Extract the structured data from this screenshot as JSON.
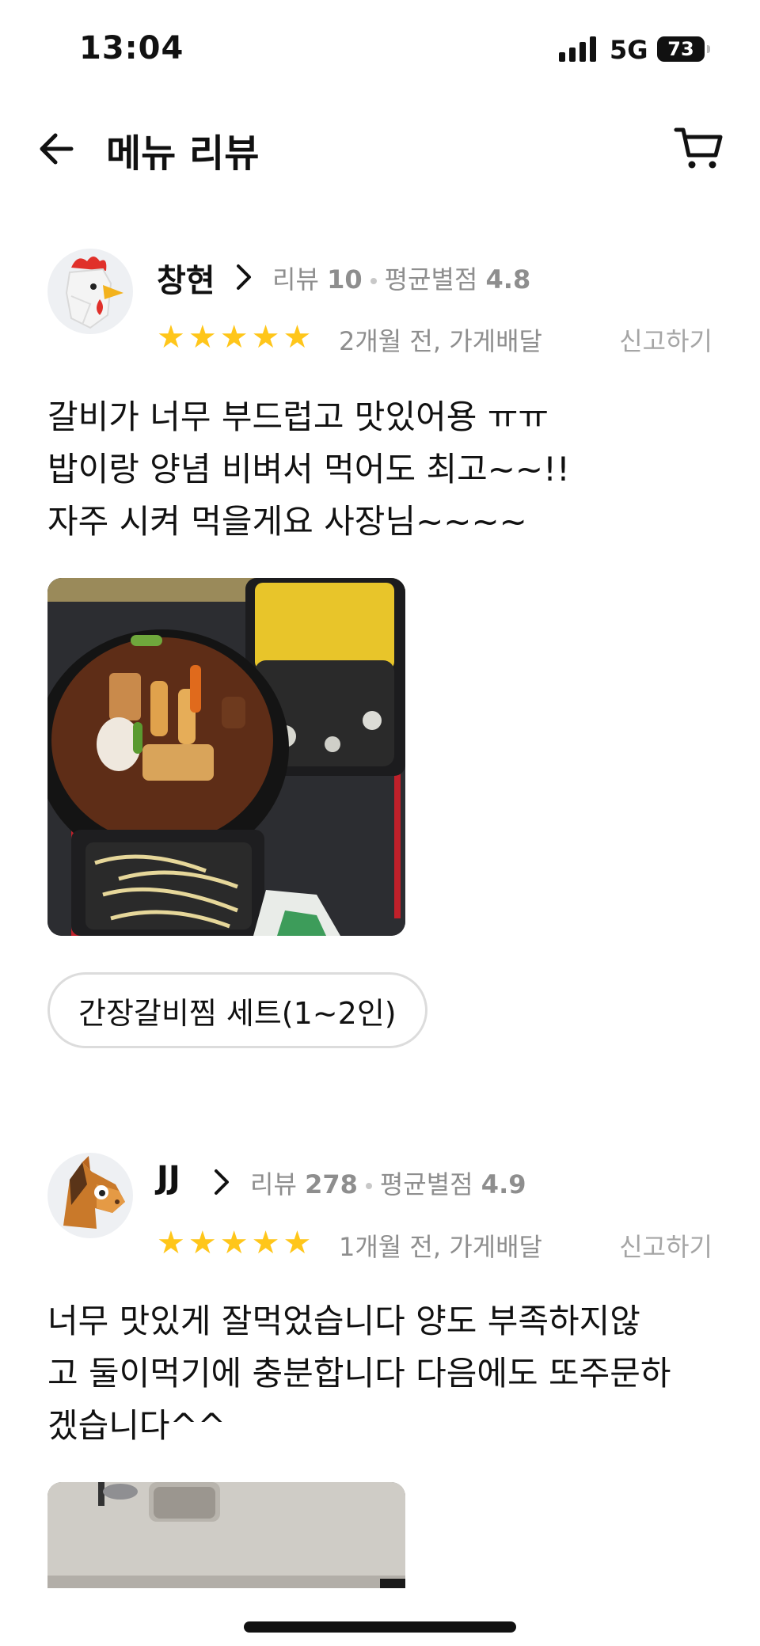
{
  "status": {
    "time": "13:04",
    "network": "5G",
    "battery": "73"
  },
  "header": {
    "title": "메뉴 리뷰"
  },
  "reviews": [
    {
      "user": "창현",
      "review_label": "리뷰",
      "review_count": "10",
      "avg_label": "평균별점",
      "avg_rating": "4.8",
      "stars": 5,
      "when": "2개월 전, 가게배달",
      "report": "신고하기",
      "text": "갈비가 너무 부드럽고 맛있어용 ㅠㅠ\n밥이랑 양념 비벼서 먹어도 최고~~!!\n자주 시켜 먹을게요 사장님~~~~",
      "menu_chip": "간장갈비찜 세트(1~2인)",
      "avatar_icon": "rooster-avatar-icon"
    },
    {
      "user": "JJ",
      "review_label": "리뷰",
      "review_count": "278",
      "avg_label": "평균별점",
      "avg_rating": "4.9",
      "stars": 5,
      "when": "1개월 전, 가게배달",
      "report": "신고하기",
      "text": "너무 맛있게 잘먹었습니다 양도 부족하지않\n고 둘이먹기에 충분합니다 다음에도 또주문하\n겠습니다^^",
      "avatar_icon": "horse-avatar-icon"
    }
  ],
  "colors": {
    "star": "#ffc61a",
    "muted": "#8e8e8e",
    "chip_border": "#dcdcdc"
  }
}
